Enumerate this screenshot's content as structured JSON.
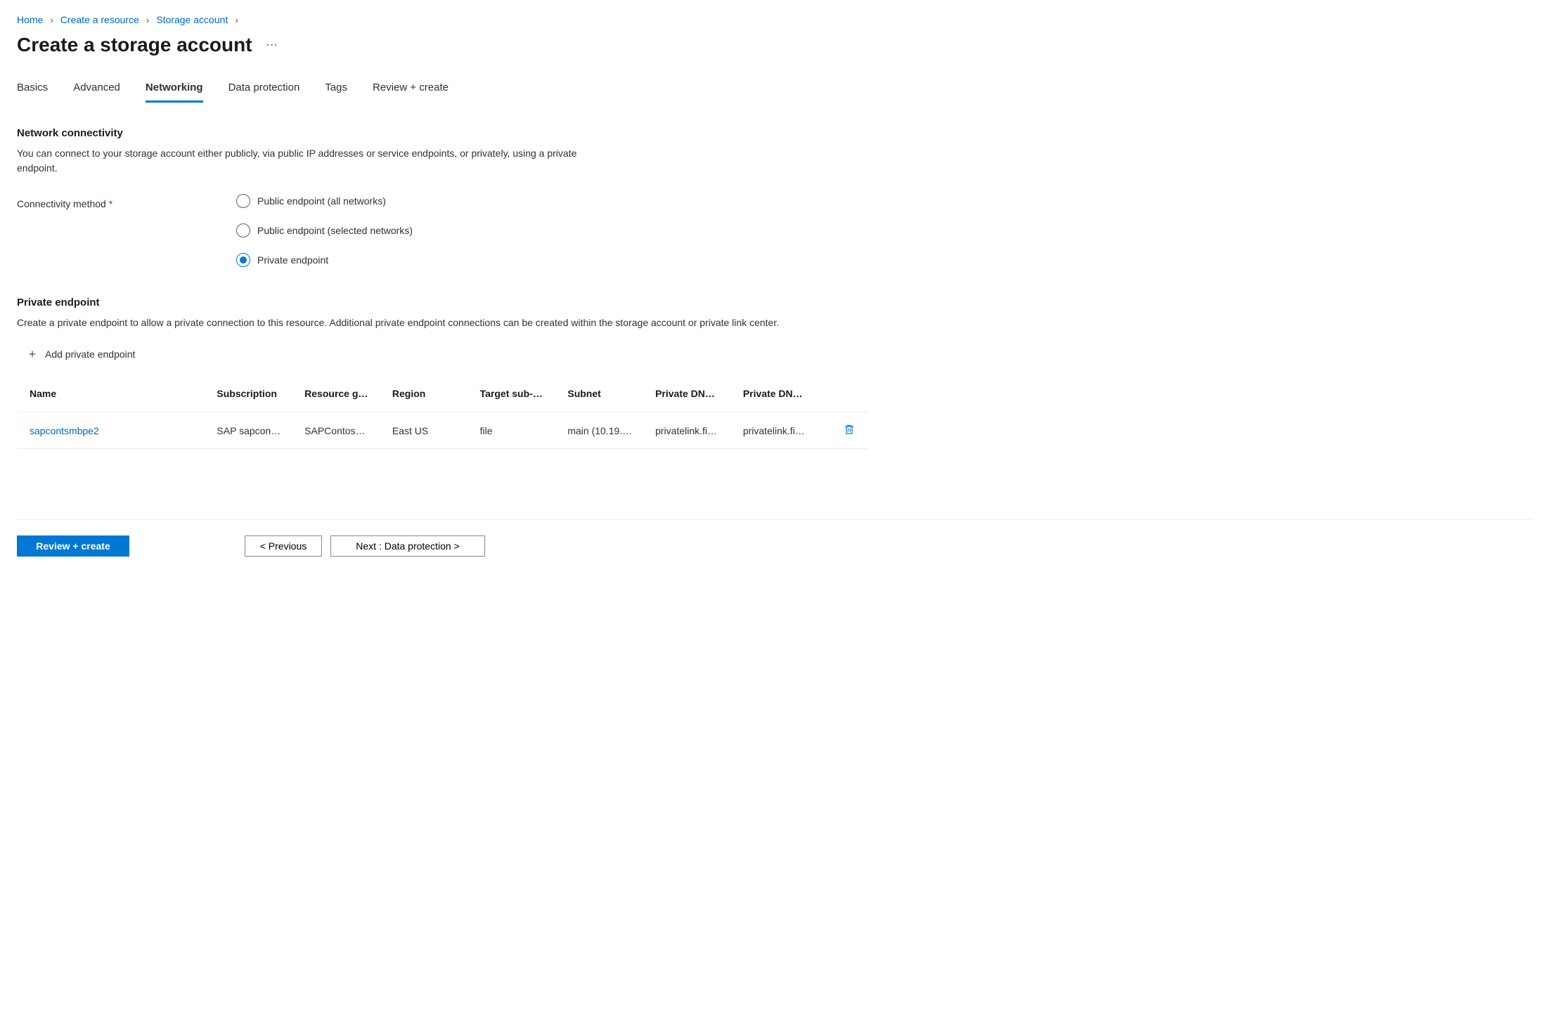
{
  "breadcrumb": {
    "items": [
      "Home",
      "Create a resource",
      "Storage account"
    ]
  },
  "title": "Create a storage account",
  "tabs": [
    {
      "label": "Basics",
      "active": false
    },
    {
      "label": "Advanced",
      "active": false
    },
    {
      "label": "Networking",
      "active": true
    },
    {
      "label": "Data protection",
      "active": false
    },
    {
      "label": "Tags",
      "active": false
    },
    {
      "label": "Review + create",
      "active": false
    }
  ],
  "network": {
    "section_title": "Network connectivity",
    "section_desc": "You can connect to your storage account either publicly, via public IP addresses or service endpoints, or privately, using a private endpoint.",
    "field_label": "Connectivity method",
    "options": [
      {
        "label": "Public endpoint (all networks)",
        "selected": false
      },
      {
        "label": "Public endpoint (selected networks)",
        "selected": false
      },
      {
        "label": "Private endpoint",
        "selected": true
      }
    ]
  },
  "private_endpoint": {
    "section_title": "Private endpoint",
    "section_desc": "Create a private endpoint to allow a private connection to this resource. Additional private endpoint connections can be created within the storage account or private link center.",
    "add_label": "Add private endpoint",
    "columns": [
      "Name",
      "Subscription",
      "Resource g…",
      "Region",
      "Target sub-…",
      "Subnet",
      "Private DN…",
      "Private DN…"
    ],
    "rows": [
      {
        "name": "sapcontsmbpe2",
        "subscription": "SAP sapcon…",
        "resource_group": "SAPContos…",
        "region": "East US",
        "target_sub": "file",
        "subnet": "main (10.19.…",
        "private_dns1": "privatelink.fi…",
        "private_dns2": "privatelink.fi…"
      }
    ]
  },
  "footer": {
    "review_label": "Review + create",
    "previous_label": "< Previous",
    "next_label": "Next : Data protection >"
  }
}
